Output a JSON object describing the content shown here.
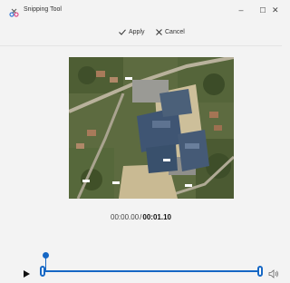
{
  "window": {
    "title": "Snipping Tool",
    "minimize_glyph": "–",
    "maximize_glyph": "☐",
    "close_glyph": "✕"
  },
  "toolbar": {
    "apply_label": "Apply",
    "cancel_label": "Cancel"
  },
  "player": {
    "current_time": "00:00.00",
    "separator": "/",
    "total_time": "00:01.10",
    "accent_color": "#1667c4"
  },
  "icons": {
    "app": "snipping-tool-icon",
    "apply": "checkmark-icon",
    "cancel": "close-icon",
    "play": "play-icon",
    "volume": "volume-icon"
  }
}
